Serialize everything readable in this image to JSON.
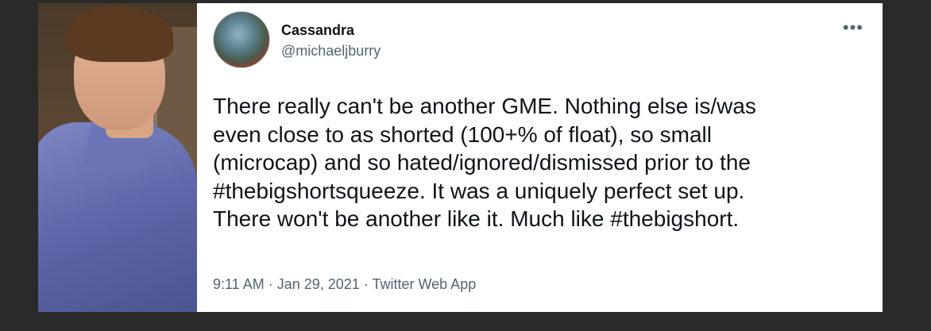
{
  "tweet": {
    "display_name": "Cassandra",
    "handle": "@michaeljburry",
    "more_icon": "•••",
    "text_lines": [
      "There really can't be another GME. Nothing else is/was",
      "even close to as shorted (100+% of float), so small",
      "(microcap) and so hated/ignored/dismissed prior to the",
      "#thebigshortsqueeze. It was a uniquely perfect set up.",
      "There won't be another like it. Much like #thebigshort."
    ],
    "time": "9:11 AM",
    "separator": " · ",
    "date": "Jan 29, 2021",
    "source": "Twitter Web App"
  },
  "colors": {
    "background": "#2a2a2a",
    "text": "#0f1419",
    "secondary": "#536471"
  }
}
